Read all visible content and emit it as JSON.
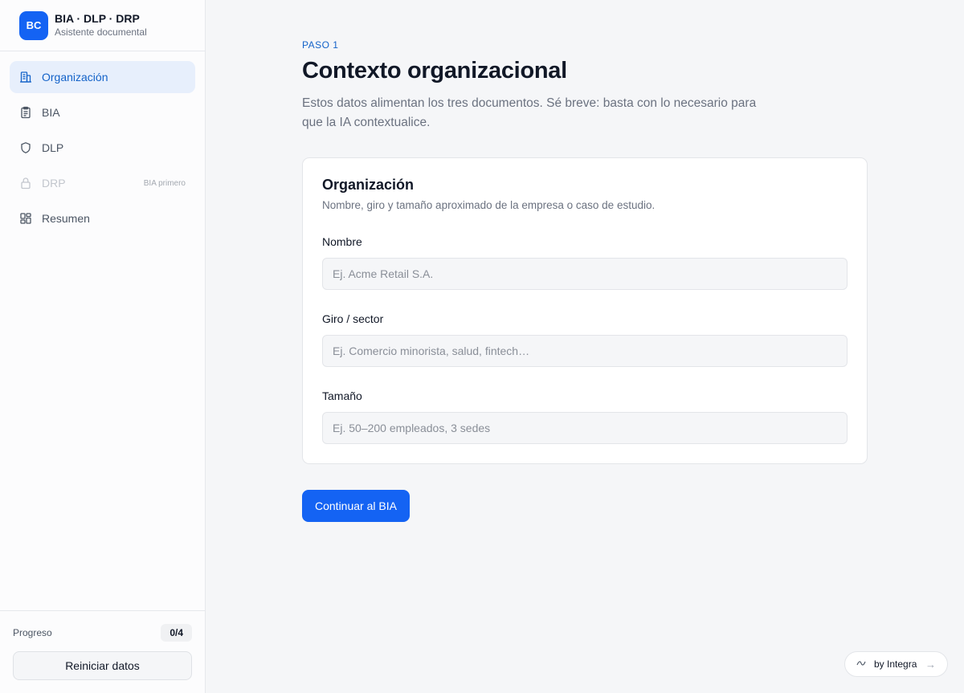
{
  "brand": {
    "logo_text": "BC",
    "title": "BIA · DLP · DRP",
    "subtitle": "Asistente documental"
  },
  "nav": {
    "items": [
      {
        "label": "Organización",
        "icon": "building-icon",
        "state": "active"
      },
      {
        "label": "BIA",
        "icon": "clipboard-icon",
        "state": "normal"
      },
      {
        "label": "DLP",
        "icon": "shield-icon",
        "state": "normal"
      },
      {
        "label": "DRP",
        "icon": "lock-icon",
        "state": "disabled",
        "hint": "BIA primero"
      },
      {
        "label": "Resumen",
        "icon": "dashboard-icon",
        "state": "normal"
      }
    ]
  },
  "footer": {
    "progress_label": "Progreso",
    "progress_value": "0/4",
    "reset_label": "Reiniciar datos"
  },
  "main": {
    "step": "PASO 1",
    "title": "Contexto organizacional",
    "subtitle": "Estos datos alimentan los tres documentos. Sé breve: basta con lo necesario para que la IA contextualice.",
    "card": {
      "title": "Organización",
      "description": "Nombre, giro y tamaño aproximado de la empresa o caso de estudio.",
      "fields": [
        {
          "label": "Nombre",
          "value": "",
          "placeholder": "Ej. Acme Retail S.A."
        },
        {
          "label": "Giro / sector",
          "value": "",
          "placeholder": "Ej. Comercio minorista, salud, fintech…"
        },
        {
          "label": "Tamaño",
          "value": "",
          "placeholder": "Ej. 50–200 empleados, 3 sedes"
        }
      ]
    },
    "continue_label": "Continuar al BIA"
  },
  "badge": {
    "label": "by Integra",
    "arrow": "→"
  },
  "colors": {
    "accent": "#1463f3",
    "active_nav_bg": "#e7effc",
    "active_nav_text": "#1463c9"
  }
}
